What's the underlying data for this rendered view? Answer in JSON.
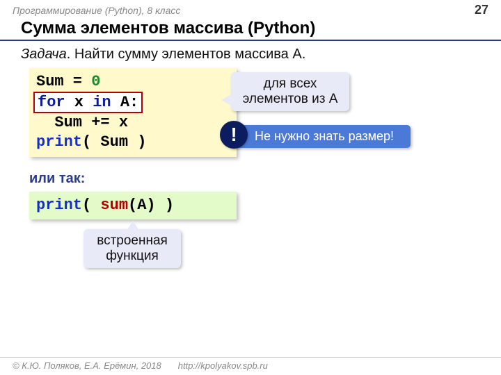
{
  "header": {
    "course": "Программирование (Python), 8 класс",
    "page": "27"
  },
  "title": "Сумма элементов массива (Python)",
  "task": {
    "prefix": "Задача",
    "text": ". Найти сумму элементов массива A."
  },
  "code1": {
    "l1a": "Sum = ",
    "l1b": "0",
    "l2a": "for",
    "l2b": " x ",
    "l2c": "in",
    "l2d": " A:",
    "l3": "  Sum += x",
    "l4a": "print",
    "l4b": "( Sum )"
  },
  "callout1": {
    "line1": "для всех",
    "line2": "элементов из A"
  },
  "callout2": {
    "bang": "!",
    "text": "Не нужно знать размер!"
  },
  "orso": "или так:",
  "code2": {
    "a": "print",
    "b": "( ",
    "c": "sum",
    "d": "(A) )"
  },
  "callout3": {
    "line1": "встроенная",
    "line2": "функция"
  },
  "footer": {
    "copyright": "© К.Ю. Поляков, Е.А. Ерёмин, 2018",
    "url": "http://kpolyakov.spb.ru"
  }
}
